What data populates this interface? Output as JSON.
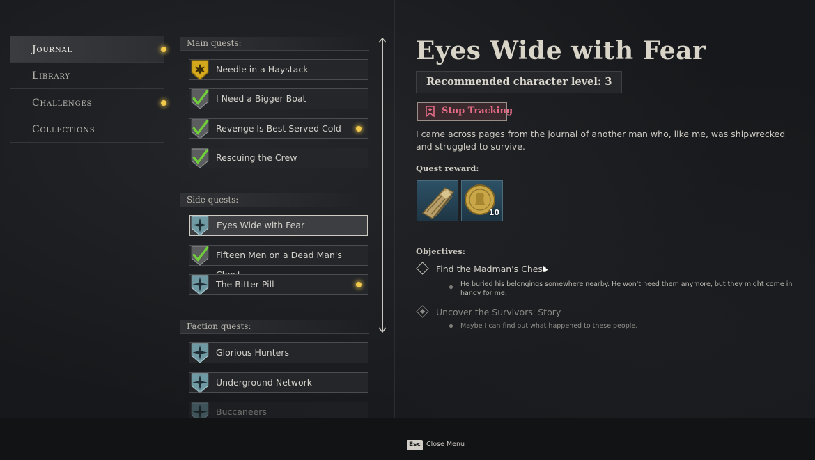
{
  "nav": {
    "items": [
      {
        "label": "Journal",
        "active": true,
        "notify": true
      },
      {
        "label": "Library",
        "active": false,
        "notify": false
      },
      {
        "label": "Challenges",
        "active": false,
        "notify": true
      },
      {
        "label": "Collections",
        "active": false,
        "notify": false
      }
    ]
  },
  "quests": {
    "main_header": "Main quests:",
    "main": [
      {
        "label": "Needle in a Haystack",
        "icon": "gold-star-shield-icon",
        "notify": false
      },
      {
        "label": "I Need a Bigger Boat",
        "icon": "checkmark-shield-icon",
        "notify": false
      },
      {
        "label": "Revenge Is Best Served Cold",
        "icon": "checkmark-shield-icon",
        "notify": true
      },
      {
        "label": "Rescuing the Crew",
        "icon": "checkmark-shield-icon",
        "notify": false
      }
    ],
    "side_header": "Side quests:",
    "side": [
      {
        "label": "Eyes Wide with Fear",
        "icon": "compass-star-shield-icon",
        "notify": false,
        "selected": true
      },
      {
        "label": "Fifteen Men on a Dead Man's Chest",
        "icon": "checkmark-shield-icon",
        "notify": false
      },
      {
        "label": "The Bitter Pill",
        "icon": "compass-star-shield-icon",
        "notify": true
      }
    ],
    "faction_header": "Faction quests:",
    "faction": [
      {
        "label": "Glorious Hunters",
        "icon": "compass-star-shield-icon"
      },
      {
        "label": "Underground Network",
        "icon": "compass-star-shield-icon"
      },
      {
        "label": "Buccaneers",
        "icon": "compass-star-shield-icon"
      }
    ]
  },
  "detail": {
    "title": "Eyes Wide with Fear",
    "level": "Recommended character level: 3",
    "stop_tracking": "Stop Tracking",
    "description": "I came across pages from the journal of another man who, like me, was shipwrecked and struggled to survive.",
    "reward_header": "Quest reward:",
    "rewards": [
      {
        "icon": "gold-bracer-icon",
        "qty": ""
      },
      {
        "icon": "gold-coin-icon",
        "qty": "10"
      }
    ],
    "objectives_header": "Objectives:",
    "objectives": [
      {
        "label": "Find the Madman's Chest",
        "done": false,
        "sub": "He buried his belongings somewhere nearby. He won't need them anymore, but they might come in handy for me."
      },
      {
        "label": "Uncover the Survivors' Story",
        "done": true,
        "sub": "Maybe I can find out what happened to these people."
      }
    ]
  },
  "footer": {
    "key": "Esc",
    "label": "Close Menu"
  },
  "colors": {
    "accent_gold": "#f2c94c",
    "stop_tracking_pink": "#e56b86",
    "check_green": "#6fce3a"
  }
}
